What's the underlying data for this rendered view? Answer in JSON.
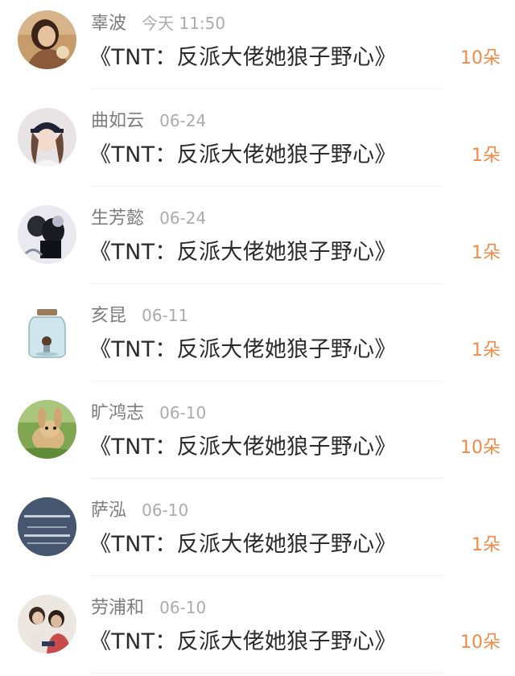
{
  "rows": [
    {
      "name": "辜波",
      "time": "今天 11:50",
      "title": "《TNT：反派大佬她狼子野心》",
      "amount": "10朵",
      "avatar": "woman-photo-avatar"
    },
    {
      "name": "曲如云",
      "time": "06-24",
      "title": "《TNT：反派大佬她狼子野心》",
      "amount": "1朵",
      "avatar": "girl-cap-avatar"
    },
    {
      "name": "生芳懿",
      "time": "06-24",
      "title": "《TNT：反派大佬她狼子野心》",
      "amount": "1朵",
      "avatar": "dark-figure-avatar"
    },
    {
      "name": "亥昆",
      "time": "06-11",
      "title": "《TNT：反派大佬她狼子野心》",
      "amount": "1朵",
      "avatar": "jar-avatar"
    },
    {
      "name": "旷鸿志",
      "time": "06-10",
      "title": "《TNT：反派大佬她狼子野心》",
      "amount": "10朵",
      "avatar": "rabbit-avatar"
    },
    {
      "name": "萨泓",
      "time": "06-10",
      "title": "《TNT：反派大佬她狼子野心》",
      "amount": "1朵",
      "avatar": "text-sign-avatar",
      "avatar_text": "你要悄悄接近 然后惊艳所有人"
    },
    {
      "name": "劳浦和",
      "time": "06-10",
      "title": "《TNT：反派大佬她狼子野心》",
      "amount": "10朵",
      "avatar": "couple-avatar"
    }
  ],
  "colors": {
    "name": "#7c7c7c",
    "time": "#ababab",
    "title": "#2b2b2b",
    "amount": "#f18a46"
  }
}
